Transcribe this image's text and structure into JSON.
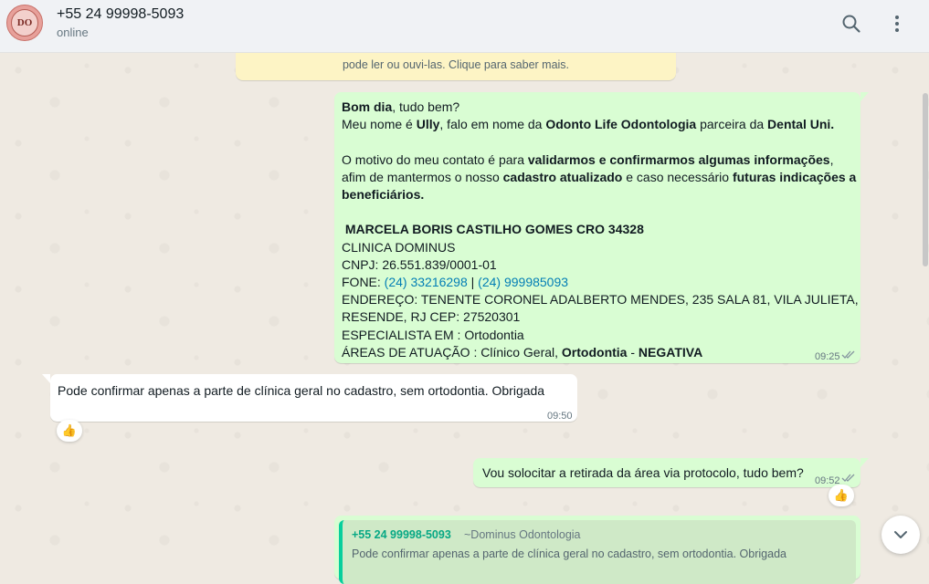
{
  "header": {
    "avatar_initials": "DO",
    "contact_name": "+55 24 99998-5093",
    "status": "online"
  },
  "notice": {
    "text": "pode ler ou ouvi-las. Clique para saber mais."
  },
  "messages": {
    "m1": {
      "l1a": "Bom dia",
      "l1b": ", tudo bem?",
      "l2a": "Meu nome é ",
      "l2b": "Ully",
      "l2c": ", falo em nome da ",
      "l2d": "Odonto Life Odontologia",
      "l2e": " parceira da ",
      "l2f": "Dental Uni.",
      "l3a": "O motivo do meu contato é para ",
      "l3b": "validarmos e confirmarmos algumas informações",
      "l3c": ",",
      "l4a": "afim de mantermos o nosso ",
      "l4b": "cadastro atualizado",
      "l4c": " e caso necessário ",
      "l4d": "futuras indicações a",
      "l5": "beneficiários.",
      "l6": " MARCELA BORIS CASTILHO GOMES CRO 34328",
      "l7": "CLINICA DOMINUS",
      "l8": "CNPJ: 26.551.839/0001-01",
      "l9a": "FONE: ",
      "l9b": "(24) 33216298",
      "l9c": " | ",
      "l9d": "(24) 999985093",
      "l10": "ENDEREÇO: TENENTE CORONEL ADALBERTO MENDES, 235 SALA 81, VILA JULIETA,",
      "l11": "RESENDE, RJ CEP: 27520301",
      "l12": "ESPECIALISTA EM : Ortodontia",
      "l13a": "ÁREAS DE ATUAÇÃO : Clínico Geral, ",
      "l13b": "Ortodontia",
      "l13c": " - ",
      "l13d": "NEGATIVA",
      "time": "09:25"
    },
    "m2": {
      "text": "Pode confirmar apenas a parte de clínica geral no cadastro, sem ortodontia. Obrigada",
      "time": "09:50",
      "reaction": "👍"
    },
    "m3": {
      "text": "Vou solocitar a retirada da área via protocolo, tudo bem?",
      "time": "09:52",
      "reaction": "👍"
    },
    "m4": {
      "quote_author": "+55 24 99998-5093",
      "quote_tag": "~Dominus Odontologia",
      "quote_text": "Pode confirmar apenas a parte de clínica geral no cadastro, sem ortodontia. Obrigada"
    }
  },
  "icons": {
    "search": "search-icon",
    "menu": "menu-icon",
    "scroll_down": "chevron-down-icon",
    "read_receipt": "double-check-icon"
  },
  "colors": {
    "outgoing_bubble": "#d9fdd3",
    "incoming_bubble": "#ffffff",
    "link": "#027eb5",
    "quote_accent": "#06cf9c"
  }
}
